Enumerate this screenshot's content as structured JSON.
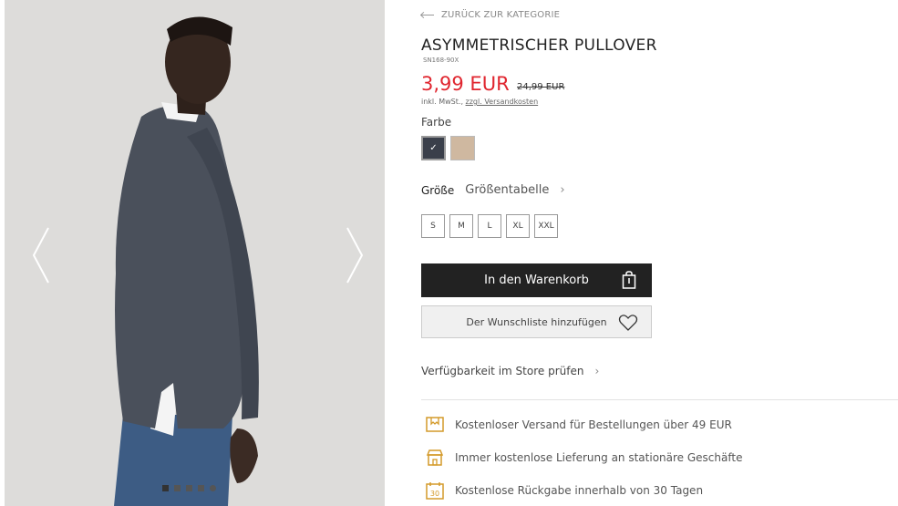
{
  "product": {
    "back_label": "ZURÜCK ZUR KATEGORIE",
    "title": "ASYMMETRISCHER PULLOVER",
    "sku": "SN168-90X",
    "price": "3,99 EUR",
    "old_price": "24,99 EUR",
    "tax_text": "inkl. MwSt., ",
    "shipping_link": "zzgl. Versandkosten",
    "color_label": "Farbe",
    "colors": [
      {
        "name": "dark-graphite",
        "hex": "#3a3f4a",
        "selected": true
      },
      {
        "name": "beige",
        "hex": "#cfb8a0",
        "selected": false
      }
    ],
    "size_label": "Größe",
    "size_table_label": "Größentabelle",
    "sizes": [
      "S",
      "M",
      "L",
      "XL",
      "XXL"
    ],
    "cart_label": "In den Warenkorb",
    "wishlist_label": "Der Wunschliste hinzufügen",
    "store_label": "Verfügbarkeit im Store prüfen",
    "accent_color": "#e0262f"
  },
  "gallery": {
    "image_count": 5,
    "active_index": 0
  },
  "benefits": [
    {
      "icon": "shipping-icon",
      "text": "Kostenloser Versand für Bestellungen über 49 EUR"
    },
    {
      "icon": "store-icon",
      "text": "Immer kostenlose Lieferung an stationäre Geschäfte"
    },
    {
      "icon": "calendar-30-icon",
      "text": "Kostenlose Rückgabe innerhalb von 30 Tagen"
    }
  ]
}
